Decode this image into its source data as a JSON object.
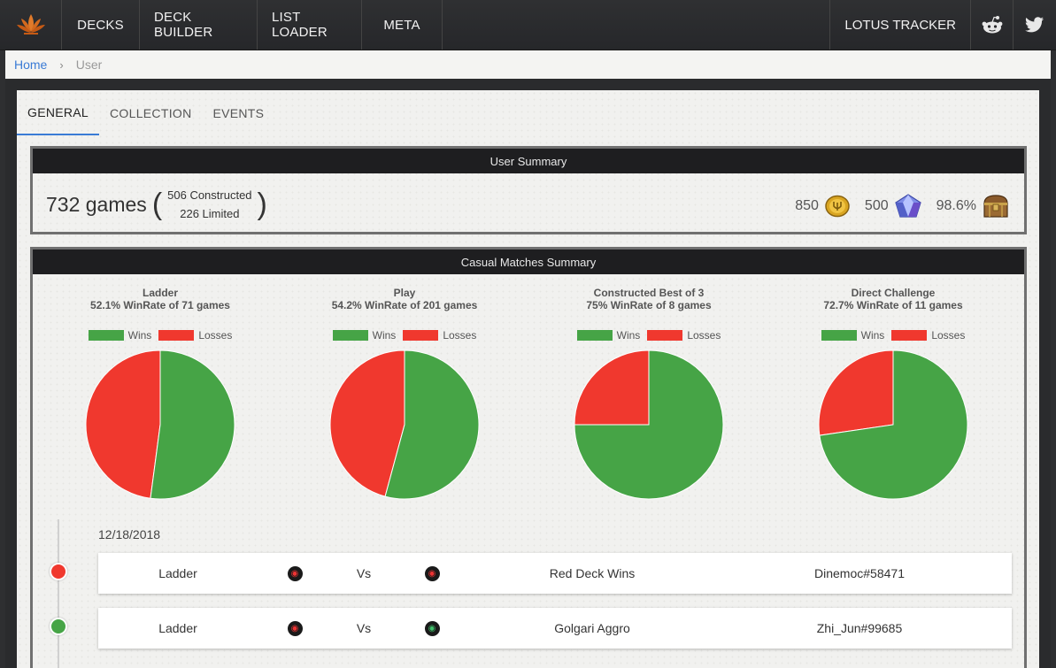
{
  "nav": {
    "items": [
      "DECKS",
      "DECK BUILDER",
      "LIST LOADER",
      "META"
    ],
    "right": "LOTUS TRACKER",
    "social": [
      "reddit-icon",
      "twitter-icon"
    ]
  },
  "breadcrumb": {
    "home": "Home",
    "separator": "›",
    "current": "User"
  },
  "tabs": [
    {
      "label": "GENERAL",
      "active": true
    },
    {
      "label": "COLLECTION",
      "active": false
    },
    {
      "label": "EVENTS",
      "active": false
    }
  ],
  "summary": {
    "header": "User Summary",
    "games": "732 games",
    "constructed": "506 Constructed",
    "limited": "226 Limited",
    "gold": "850",
    "gems": "500",
    "vault": "98.6%"
  },
  "matches": {
    "header": "Casual Matches Summary",
    "legend_wins": "Wins",
    "legend_losses": "Losses",
    "colors": {
      "wins": "#46a446",
      "losses": "#f0382e"
    },
    "charts": [
      {
        "title": "Ladder",
        "subtitle": "52.1% WinRate of 71 games",
        "win_fraction": 0.521
      },
      {
        "title": "Play",
        "subtitle": "54.2% WinRate of 201 games",
        "win_fraction": 0.542
      },
      {
        "title": "Constructed Best of 3",
        "subtitle": "75% WinRate of 8 games",
        "win_fraction": 0.75
      },
      {
        "title": "Direct Challenge",
        "subtitle": "72.7% WinRate of 11 games",
        "win_fraction": 0.727
      }
    ]
  },
  "timeline": {
    "date": "12/18/2018",
    "rows": [
      {
        "result": "loss",
        "mode": "Ladder",
        "vs": "Vs",
        "deck": "Red Deck Wins",
        "opponent": "Dinemoc#58471",
        "my_color": "red-mana-icon",
        "opp_color": "red-mana-icon"
      },
      {
        "result": "win",
        "mode": "Ladder",
        "vs": "Vs",
        "deck": "Golgari Aggro",
        "opponent": "Zhi_Jun#99685",
        "my_color": "red-mana-icon",
        "opp_color": "green-mana-icon"
      }
    ]
  }
}
